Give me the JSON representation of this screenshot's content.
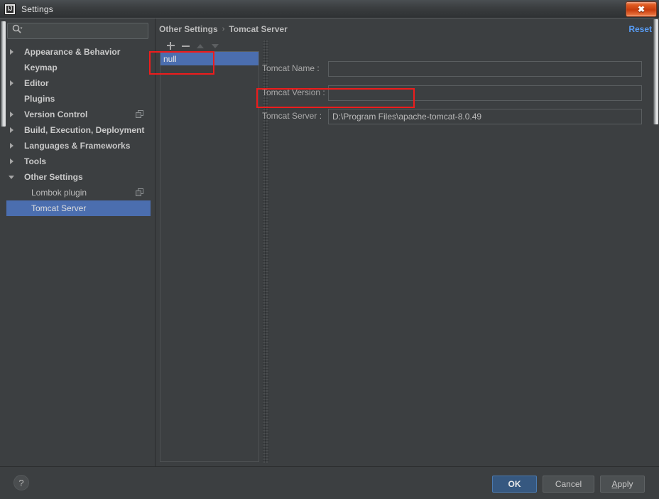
{
  "window": {
    "title": "Settings",
    "icon": "intellij-idea-icon",
    "close_label": "✖"
  },
  "search": {
    "placeholder": "",
    "value": "",
    "icon": "search-icon"
  },
  "sidebar": {
    "items": [
      {
        "label": "Appearance & Behavior",
        "twisty": "right",
        "bold": true,
        "indent": false,
        "selected": false,
        "badge": ""
      },
      {
        "label": "Keymap",
        "twisty": "none",
        "bold": true,
        "indent": false,
        "selected": false,
        "badge": ""
      },
      {
        "label": "Editor",
        "twisty": "right",
        "bold": true,
        "indent": false,
        "selected": false,
        "badge": ""
      },
      {
        "label": "Plugins",
        "twisty": "none",
        "bold": true,
        "indent": false,
        "selected": false,
        "badge": ""
      },
      {
        "label": "Version Control",
        "twisty": "right",
        "bold": true,
        "indent": false,
        "selected": false,
        "badge": "copy-icon"
      },
      {
        "label": "Build, Execution, Deployment",
        "twisty": "right",
        "bold": true,
        "indent": false,
        "selected": false,
        "badge": ""
      },
      {
        "label": "Languages & Frameworks",
        "twisty": "right",
        "bold": true,
        "indent": false,
        "selected": false,
        "badge": ""
      },
      {
        "label": "Tools",
        "twisty": "right",
        "bold": true,
        "indent": false,
        "selected": false,
        "badge": ""
      },
      {
        "label": "Other Settings",
        "twisty": "down",
        "bold": true,
        "indent": false,
        "selected": false,
        "badge": ""
      },
      {
        "label": "Lombok plugin",
        "twisty": "none",
        "bold": false,
        "indent": true,
        "selected": false,
        "badge": "copy-icon"
      },
      {
        "label": "Tomcat Server",
        "twisty": "none",
        "bold": false,
        "indent": true,
        "selected": true,
        "badge": ""
      }
    ]
  },
  "breadcrumb": {
    "root": "Other Settings",
    "separator": "›",
    "current": "Tomcat Server"
  },
  "reset": {
    "label": "Reset"
  },
  "list_panel": {
    "toolbar": [
      {
        "name": "add-button",
        "icon": "plus-icon",
        "enabled": true
      },
      {
        "name": "remove-button",
        "icon": "minus-icon",
        "enabled": true
      },
      {
        "name": "move-up-button",
        "icon": "arrow-up-icon",
        "enabled": false
      },
      {
        "name": "move-down-button",
        "icon": "arrow-down-icon",
        "enabled": false
      }
    ],
    "rows": [
      {
        "label": "null",
        "selected": true
      }
    ]
  },
  "form": {
    "fields": [
      {
        "label": "Tomcat Name :",
        "value": "",
        "placeholder": "",
        "highlighted": false
      },
      {
        "label": "Tomcat Version :",
        "value": "",
        "placeholder": "",
        "highlighted": false
      },
      {
        "label": "Tomcat Server :",
        "value": "D:\\Program Files\\apache-tomcat-8.0.49",
        "placeholder": "",
        "highlighted": true
      }
    ]
  },
  "footer": {
    "help_label": "?",
    "ok_label": "OK",
    "cancel_label": "Cancel",
    "apply_label_prefix": "A",
    "apply_label_rest": "pply"
  },
  "colors": {
    "background": "#3c3f41",
    "selection_blue": "#4b6eaf",
    "accent_link": "#589df6",
    "ok_button": "#365880",
    "annotation_red": "#ee1c1c",
    "text": "#bbbbbb"
  }
}
